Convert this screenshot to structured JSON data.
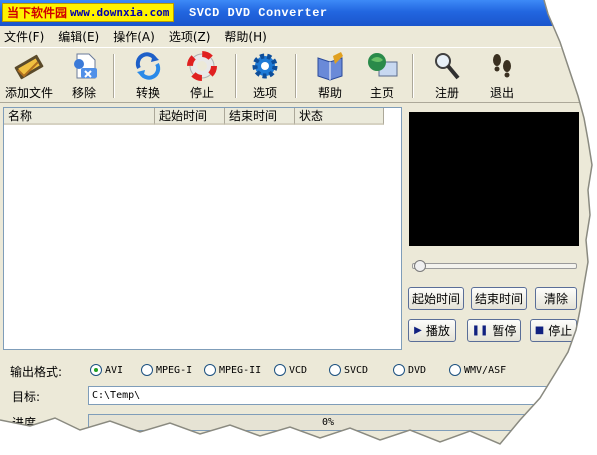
{
  "titlebar": {
    "logo_cn": "当下软件园",
    "logo_url": "www.downxia.com",
    "title": "SVCD DVD Converter"
  },
  "menu": [
    {
      "label": "文件(F)"
    },
    {
      "label": "编辑(E)"
    },
    {
      "label": "操作(A)"
    },
    {
      "label": "选项(Z)"
    },
    {
      "label": "帮助(H)"
    }
  ],
  "toolbar": {
    "add_file": "添加文件",
    "remove": "移除",
    "convert": "转换",
    "stop": "停止",
    "options": "选项",
    "help": "帮助",
    "home": "主页",
    "register": "注册",
    "exit": "退出"
  },
  "filelist": {
    "columns": [
      "名称",
      "起始时间",
      "结束时间",
      "状态"
    ]
  },
  "player": {
    "start_time": "起始时间",
    "end_time": "结束时间",
    "clear": "清除",
    "play": "播放",
    "pause": "暂停",
    "stop": "停止",
    "position": 0
  },
  "output": {
    "label": "输出格式:",
    "formats": [
      "AVI",
      "MPEG-I",
      "MPEG-II",
      "VCD",
      "SVCD",
      "DVD",
      "WMV/ASF"
    ],
    "selected": "AVI"
  },
  "target": {
    "label": "目标:",
    "value": "C:\\Temp\\"
  },
  "progress": {
    "label": "进度",
    "text": "0%",
    "value": 0
  },
  "colors": {
    "titlebar": "#2266e0",
    "window": "#ece9d8",
    "preview": "#000000"
  }
}
